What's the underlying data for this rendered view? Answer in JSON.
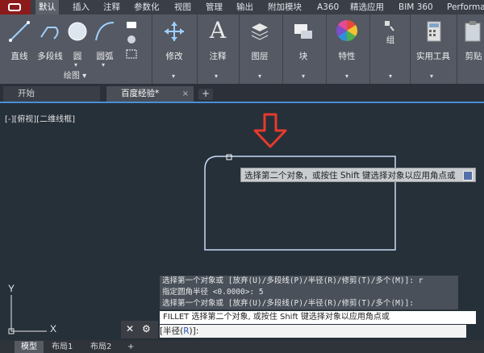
{
  "ribbon": {
    "tabs": [
      "默认",
      "插入",
      "注释",
      "参数化",
      "视图",
      "管理",
      "输出",
      "附加模块",
      "A360",
      "精选应用",
      "BIM 360",
      "Performa"
    ],
    "active_tab": "默认",
    "draw_group": {
      "title": "绘图",
      "tools": [
        "直线",
        "多段线",
        "圆",
        "圆弧"
      ]
    },
    "tools": {
      "modify": "修改",
      "annotate": "注释",
      "layers": "图层",
      "block": "块",
      "properties": "特性",
      "group": "组",
      "utilities": "实用工具",
      "clipboard": "剪贴"
    }
  },
  "doc_tabs": {
    "start": "开始",
    "active": "百度经验*",
    "close": "×",
    "add": "+"
  },
  "viewport": {
    "label": "[-][俯视][二维线框]",
    "axis_y": "Y",
    "axis_x": "X"
  },
  "tooltip": {
    "text": "选择第二个对象，或按住 Shift 键选择对象以应用角点或"
  },
  "command": {
    "history": [
      "选择第一个对象或 [放弃(U)/多段线(P)/半径(R)/修剪(T)/多个(M)]: r",
      "指定圆角半径 <0.0000>: 5",
      "选择第一个对象或 [放弃(U)/多段线(P)/半径(R)/修剪(T)/多个(M)]:"
    ],
    "current": "FILLET 选择第二个对象, 或按住 Shift 键选择对象以应用角点或",
    "prompt_prefix": "[半径(",
    "prompt_option": "R",
    "prompt_suffix": ")]:"
  },
  "layout_tabs": [
    "模型",
    "布局1",
    "布局2"
  ],
  "layout_add": "+",
  "colors": {
    "canvas": "#263039",
    "ribbon": "#545963",
    "arrow": "#e53a2c",
    "shape": "#c7d9f5"
  }
}
